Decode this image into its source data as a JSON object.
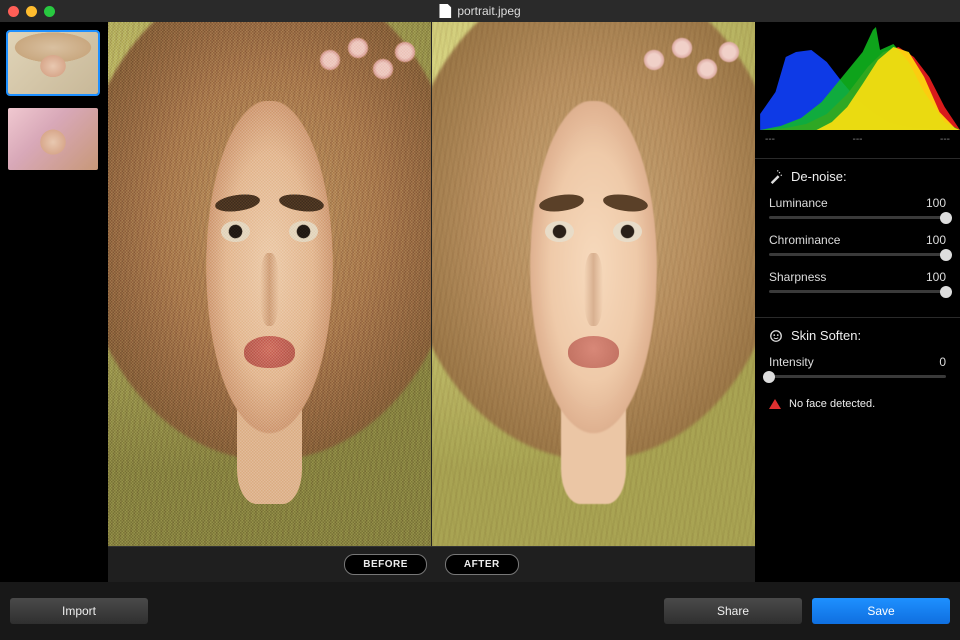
{
  "title": "portrait.jpeg",
  "toggle": {
    "before": "BEFORE",
    "after": "AFTER"
  },
  "histogram": {
    "labels": [
      "---",
      "---",
      "---"
    ]
  },
  "sections": {
    "denoise": {
      "title": "De-noise:",
      "luminance": {
        "label": "Luminance",
        "value": "100"
      },
      "chrominance": {
        "label": "Chrominance",
        "value": "100"
      },
      "sharpness": {
        "label": "Sharpness",
        "value": "100"
      }
    },
    "skin": {
      "title": "Skin Soften:",
      "intensity": {
        "label": "Intensity",
        "value": "0"
      },
      "warning": "No face detected."
    }
  },
  "buttons": {
    "import": "Import",
    "share": "Share",
    "save": "Save"
  }
}
